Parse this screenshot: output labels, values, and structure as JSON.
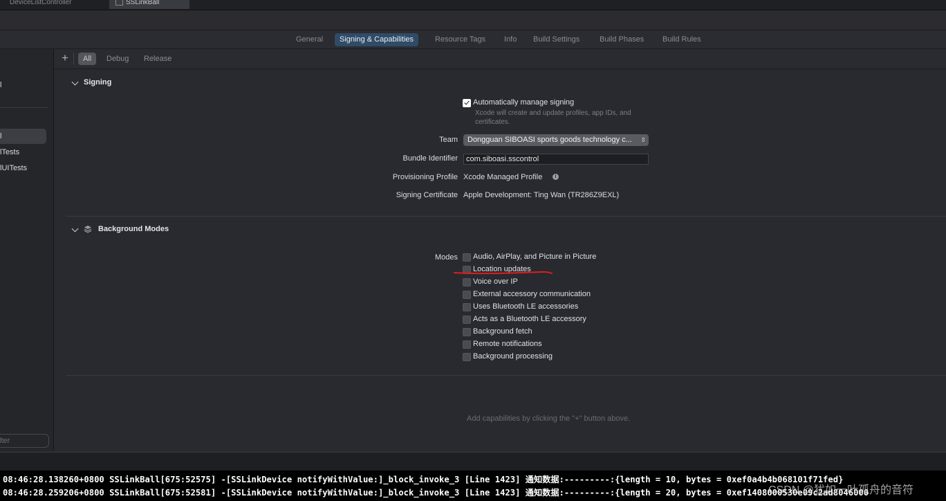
{
  "file_tabs": [
    {
      "label": "DeviceListController"
    },
    {
      "label": "SSLinkBall"
    }
  ],
  "editor_tabs": [
    {
      "label": "General"
    },
    {
      "label": "Signing & Capabilities",
      "active": true
    },
    {
      "label": "Resource Tags"
    },
    {
      "label": "Info"
    },
    {
      "label": "Build Settings"
    },
    {
      "label": "Build Phases"
    },
    {
      "label": "Build Rules"
    }
  ],
  "sidebar": {
    "items": [
      {
        "label": "l"
      },
      {
        "label": "l"
      },
      {
        "label": "lTests"
      },
      {
        "label": "lUITests"
      }
    ],
    "filter_placeholder": "lter"
  },
  "filter_bar": {
    "plus": "+",
    "buttons": [
      {
        "label": "All",
        "active": true
      },
      {
        "label": "Debug"
      },
      {
        "label": "Release"
      }
    ]
  },
  "signing": {
    "header": "Signing",
    "auto_manage_label": "Automatically manage signing",
    "auto_manage_checked": true,
    "auto_manage_hint": "Xcode will create and update profiles, app IDs, and certificates.",
    "team_label": "Team",
    "team_value": "Dongguan SIBOASI sports goods technology c...",
    "bundle_label": "Bundle Identifier",
    "bundle_value": "com.siboasi.sscontrol",
    "profile_label": "Provisioning Profile",
    "profile_value": "Xcode Managed Profile",
    "cert_label": "Signing Certificate",
    "cert_value": "Apple Development: Ting Wan (TR286Z9EXL)"
  },
  "background_modes": {
    "header": "Background Modes",
    "modes_label": "Modes",
    "options": [
      {
        "label": "Audio, AirPlay, and Picture in Picture",
        "checked": false
      },
      {
        "label": "Location updates",
        "checked": false
      },
      {
        "label": "Voice over IP",
        "checked": false
      },
      {
        "label": "External accessory communication",
        "checked": false
      },
      {
        "label": "Uses Bluetooth LE accessories",
        "checked": false
      },
      {
        "label": "Acts as a Bluetooth LE accessory",
        "checked": false
      },
      {
        "label": "Background fetch",
        "checked": false
      },
      {
        "label": "Remote notifications",
        "checked": false
      },
      {
        "label": "Background processing",
        "checked": false
      }
    ]
  },
  "add_hint": "Add capabilities by clicking the \"+\" button above.",
  "console": {
    "lines": [
      "08:46:28.138260+0800 SSLinkBall[675:52575] -[SSLinkDevice notifyWithValue:]_block_invoke_3 [Line 1423] 通知数据:---------:{length = 10, bytes = 0xef0a4b4b068101f71fed}",
      "08:46:28.259206+0800 SSLinkBall[675:52581] -[SSLinkDevice notifyWithValue:]_block_invoke_3 [Line 1423] 通知数据:---------:{length = 20, bytes = 0xef1408000530e09c2ad8046000"
    ]
  },
  "watermark": "CSDN @犹如一叶孤舟的音符",
  "colors": {
    "accent": "#2f4b66",
    "annotation_red": "#e01e1e",
    "background": "#292a30"
  }
}
